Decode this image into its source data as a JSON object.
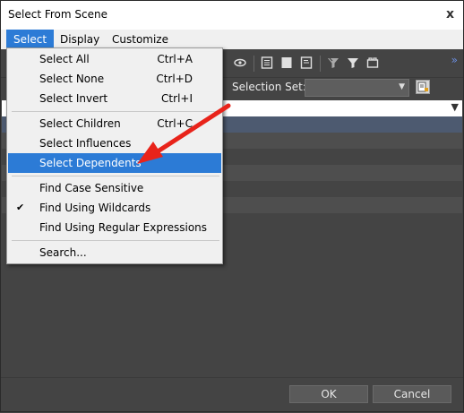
{
  "window": {
    "title": "Select From Scene",
    "close_glyph": "x"
  },
  "menubar": {
    "items": [
      "Select",
      "Display",
      "Customize"
    ]
  },
  "toolbar": {
    "selection_set_label": "Selection Set:",
    "selection_set_value": "",
    "overflow_glyph": "»"
  },
  "list_header": {
    "sort_glyph": "▼"
  },
  "dropdown": {
    "items": [
      {
        "label": "Select All",
        "shortcut": "Ctrl+A",
        "checked": false,
        "highlighted": false
      },
      {
        "label": "Select None",
        "shortcut": "Ctrl+D",
        "checked": false,
        "highlighted": false
      },
      {
        "label": "Select Invert",
        "shortcut": "Ctrl+I",
        "checked": false,
        "highlighted": false
      },
      {
        "label": "Select Children",
        "shortcut": "Ctrl+C",
        "checked": false,
        "highlighted": false
      },
      {
        "label": "Select Influences",
        "shortcut": "",
        "checked": false,
        "highlighted": false
      },
      {
        "label": "Select Dependents",
        "shortcut": "",
        "checked": false,
        "highlighted": true
      },
      {
        "label": "Find Case Sensitive",
        "shortcut": "",
        "checked": false,
        "highlighted": false
      },
      {
        "label": "Find Using Wildcards",
        "shortcut": "",
        "checked": true,
        "highlighted": false
      },
      {
        "label": "Find Using Regular Expressions",
        "shortcut": "",
        "checked": false,
        "highlighted": false
      },
      {
        "label": "Search...",
        "shortcut": "",
        "checked": false,
        "highlighted": false
      }
    ],
    "check_glyph": "✔"
  },
  "footer": {
    "ok_label": "OK",
    "cancel_label": "Cancel"
  },
  "colors": {
    "accent": "#2c7bd6",
    "panel": "#444444",
    "annotation_arrow": "#e8231a"
  }
}
